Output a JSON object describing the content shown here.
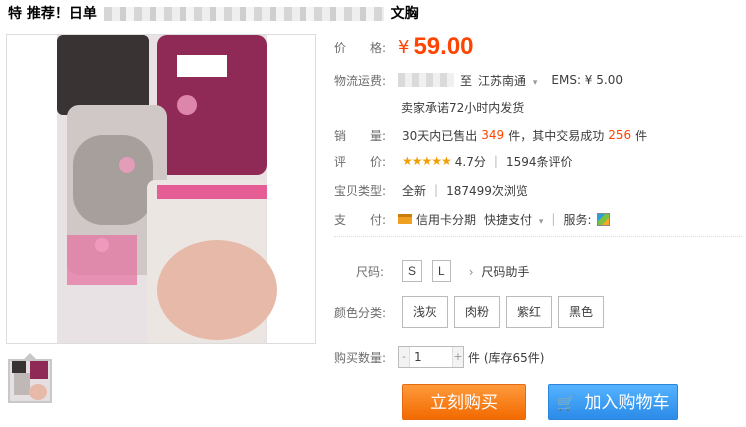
{
  "title": {
    "prefix": "特 推荐！日单",
    "suffix": "文胸"
  },
  "price": {
    "label": "价　　格:",
    "symbol": "¥",
    "value": "59.00"
  },
  "shipping": {
    "label": "物流运费:",
    "to": "至",
    "destination": "江苏南通",
    "caret": "▾",
    "ems": "EMS: ¥ 5.00",
    "promise": "卖家承诺72小时内发货"
  },
  "sales": {
    "label": "销　　量:",
    "prefix": "30天内已售出",
    "sold": "349",
    "mid": "件，其中交易成功",
    "success": "256",
    "suffix": "件"
  },
  "rating": {
    "label": "评　　价:",
    "stars": "★★★★★",
    "score": "4.7分",
    "reviews": "1594条评价"
  },
  "item_type": {
    "label": "宝贝类型:",
    "condition": "全新",
    "views": "187499次浏览"
  },
  "payment": {
    "label": "支　　付:",
    "credit": "信用卡分期",
    "express": "快捷支付",
    "express_caret": "▾",
    "services_label": "服务:"
  },
  "size": {
    "label": "尺码:",
    "options": [
      "S",
      "L"
    ],
    "helper": "尺码助手",
    "helper_icon": "›"
  },
  "colors": {
    "label": "颜色分类:",
    "options": [
      "浅灰",
      "肉粉",
      "紫红",
      "黑色"
    ]
  },
  "quantity": {
    "label": "购买数量:",
    "minus": "-",
    "value": "1",
    "plus": "+",
    "stock": "件 (库存65件)"
  },
  "actions": {
    "buy": "立刻购买",
    "cart": "加入购物车",
    "cart_icon": "🛒"
  }
}
